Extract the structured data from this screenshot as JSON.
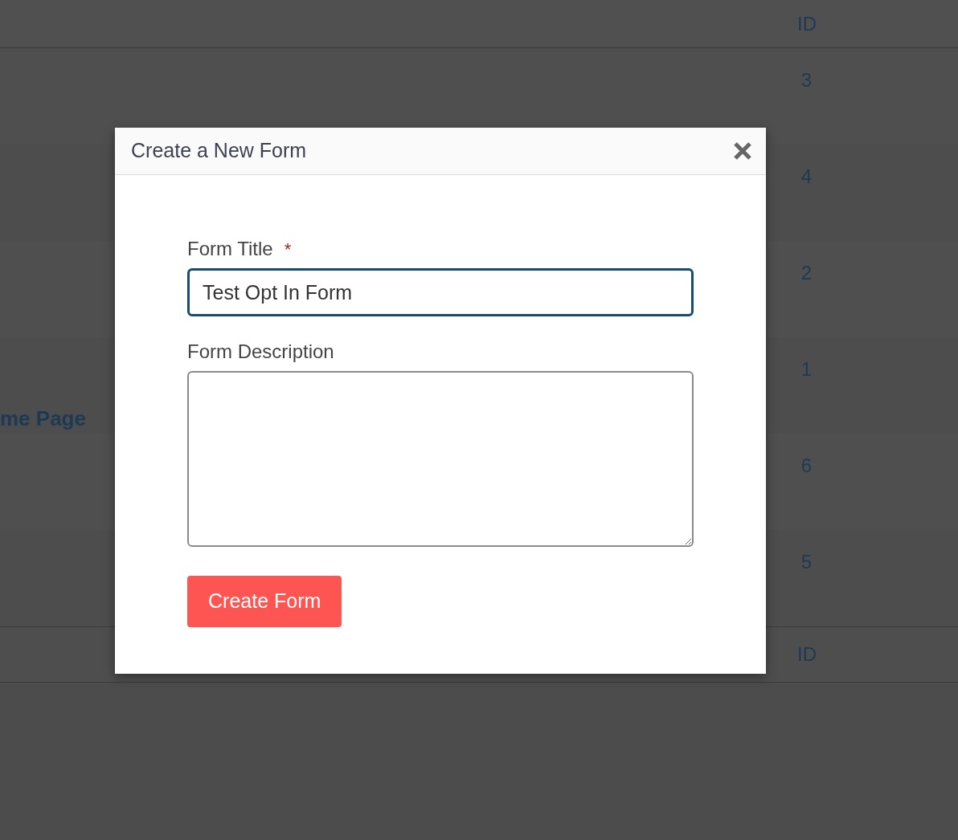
{
  "table": {
    "header": {
      "id_label": "ID"
    },
    "rows": [
      {
        "id": "3"
      },
      {
        "id": "4"
      },
      {
        "id": "2"
      },
      {
        "title": "me Page",
        "id": "1"
      },
      {
        "id": "6"
      },
      {
        "id": "5"
      }
    ],
    "footer": {
      "id_label": "ID"
    }
  },
  "modal": {
    "title": "Create a New Form",
    "fields": [
      {
        "kind": "input",
        "label": "Form Title",
        "required_mark": "*",
        "value": "Test Opt In Form",
        "focused": true
      },
      {
        "kind": "textarea",
        "label": "Form Description",
        "focused": false
      }
    ],
    "submit_button": "Create Form"
  }
}
